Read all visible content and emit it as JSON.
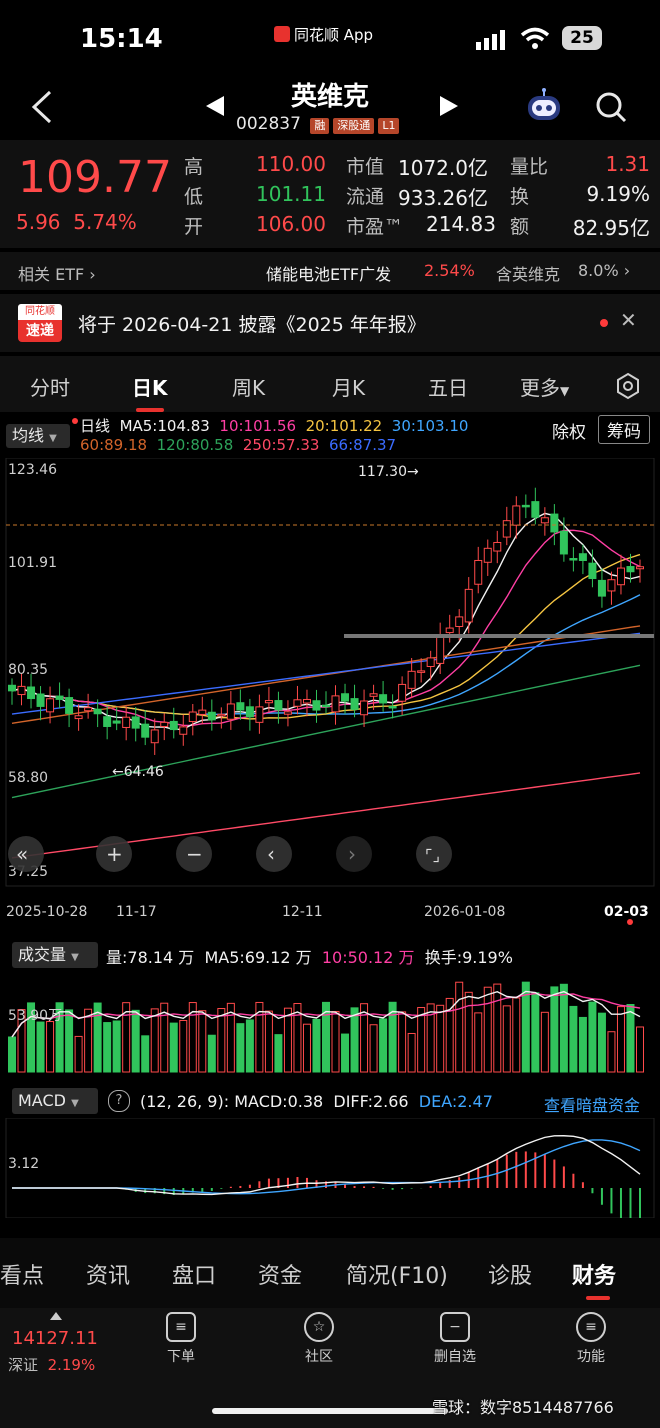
{
  "status_bar": {
    "time": "15:14",
    "app_name": "同花顺 App",
    "battery": "25"
  },
  "header": {
    "title": "英维克",
    "code": "002837",
    "tags": [
      "融",
      "深股通",
      "L1"
    ]
  },
  "quote": {
    "price": "109.77",
    "change": "5.96",
    "change_pct": "5.74%",
    "labels": {
      "high": "高",
      "low": "低",
      "open": "开",
      "mktcap": "市值",
      "float": "流通",
      "pe": "市盈™",
      "vol_ratio": "量比",
      "turnover": "换",
      "amount": "额"
    },
    "high": "110.00",
    "low": "101.11",
    "open": "106.00",
    "mktcap": "1072.0亿",
    "float": "933.26亿",
    "pe": "214.83",
    "vol_ratio": "1.31",
    "turnover": "9.19%",
    "amount": "82.95亿"
  },
  "etf": {
    "label": "相关 ETF",
    "name": "储能电池ETF广发",
    "pct": "2.54%",
    "contains_label": "含英维克",
    "contains_pct": "8.0%"
  },
  "news": {
    "badge_top": "同花顺",
    "badge_bottom": "速递",
    "text": "将于 2026-04-21 披露《2025 年年报》"
  },
  "tabs": [
    "分时",
    "日K",
    "周K",
    "月K",
    "五日",
    "更多"
  ],
  "active_tab": "日K",
  "ma_bar": {
    "selector": "均线",
    "period": "日线",
    "ma5": "MA5:104.83",
    "ma10": "10:101.56",
    "ma20": "20:101.22",
    "ma30": "30:103.10",
    "ma60": "60:89.18",
    "ma120": "120:80.58",
    "ma250": "250:57.33",
    "ma66": "66:87.37",
    "adj": "除权",
    "chip": "筹码"
  },
  "kline": {
    "y_labels": [
      "123.46",
      "101.91",
      "80.35",
      "58.80",
      "37.25"
    ],
    "high_note": "117.30→",
    "low_note": "←64.46",
    "x_labels": [
      "2025-10-28",
      "11-17",
      "12-11",
      "2026-01-08",
      "02-03"
    ]
  },
  "colors": {
    "up": "#ff4a4a",
    "down": "#31c45c",
    "ma5": "#f2f2f2",
    "ma10": "#ff3fa4",
    "ma20": "#f5c542",
    "ma30": "#3fa6ff",
    "ma60": "#d2642a",
    "ma120": "#2da35a",
    "ma250": "#ff4a66",
    "ma66": "#3b6cff"
  },
  "volume": {
    "selector": "成交量",
    "vol": "量:78.14 万",
    "ma5": "MA5:69.12 万",
    "ma10": "10:50.12 万",
    "turnover": "换手:9.19%",
    "y_label": "53.90万"
  },
  "macd": {
    "selector": "MACD",
    "params": "(12, 26, 9):",
    "macd": "MACD:0.38",
    "diff": "DIFF:2.66",
    "dea": "DEA:2.47",
    "link": "查看暗盘资金",
    "y_label": "3.12"
  },
  "bottom_tabs": [
    "看点",
    "资讯",
    "盘口",
    "资金",
    "简况(F10)",
    "诊股",
    "财务"
  ],
  "active_bottom_tab": "财务",
  "nav": {
    "index_value": "14127.11",
    "index_name": "深证",
    "index_pct": "2.19%",
    "items": [
      {
        "label": "下单",
        "icon": "order-icon"
      },
      {
        "label": "社区",
        "icon": "community-icon"
      },
      {
        "label": "删自选",
        "icon": "remove-watchlist-icon"
      },
      {
        "label": "功能",
        "icon": "menu-icon"
      }
    ]
  },
  "watermark": "雪球：数字8514487766"
}
